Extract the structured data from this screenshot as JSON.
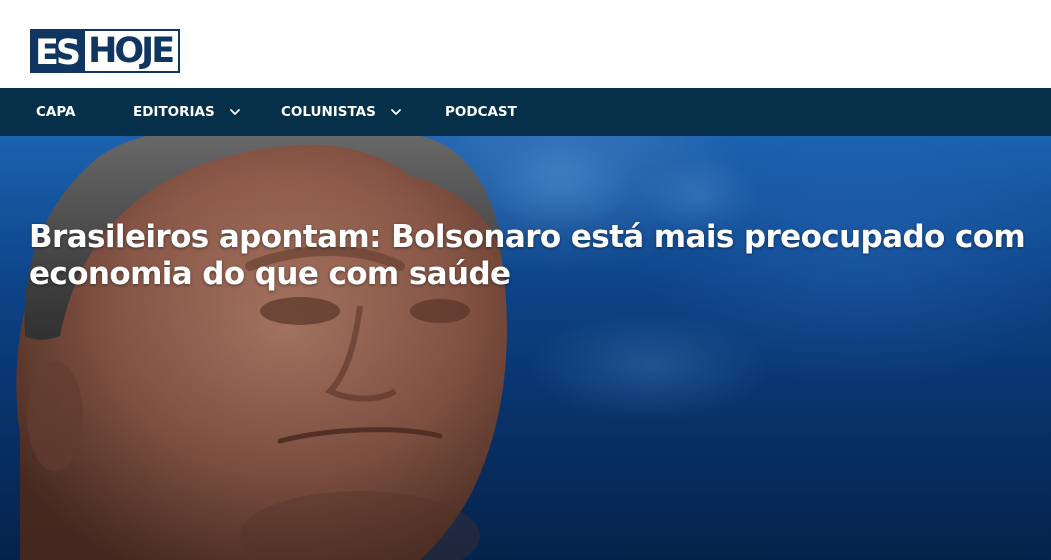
{
  "header": {
    "logo": {
      "part_es": "ES",
      "part_hoje": "HOJE",
      "brand_color": "#0f3560"
    }
  },
  "nav": {
    "background": "#06304a",
    "items": [
      {
        "label": "CAPA",
        "has_dropdown": false
      },
      {
        "label": "EDITORIAS",
        "has_dropdown": true,
        "icon": "chevron-down-icon"
      },
      {
        "label": "COLUNISTAS",
        "has_dropdown": true,
        "icon": "chevron-down-icon"
      },
      {
        "label": "PODCAST",
        "has_dropdown": false
      }
    ]
  },
  "hero": {
    "headline": "Brasileiros apontam: Bolsonaro está mais preocupado com economia do que com saúde"
  }
}
